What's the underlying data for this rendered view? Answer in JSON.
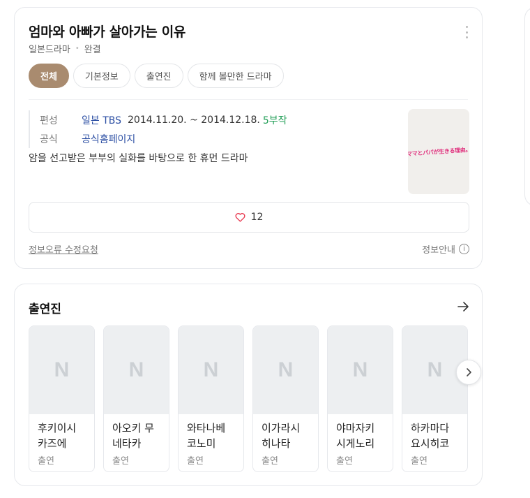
{
  "drama": {
    "title": "엄마와 아빠가 살아가는 이유",
    "genre": "일본드라마",
    "status": "완결"
  },
  "tabs": [
    {
      "label": "전체",
      "active": true
    },
    {
      "label": "기본정보",
      "active": false
    },
    {
      "label": "출연진",
      "active": false
    },
    {
      "label": "함께 볼만한 드라마",
      "active": false
    }
  ],
  "info": {
    "broadcast_label": "편성",
    "channel": "일본 TBS",
    "dates": "2014.11.20. ~ 2014.12.18.",
    "episodes": "5부작",
    "official_label": "공식",
    "official_link": "공식홈페이지"
  },
  "synopsis": "암을 선고받은 부부의 실화를 바탕으로 한 휴먼 드라마",
  "poster": {
    "text": "ママとパパが生きる理由。"
  },
  "likes": {
    "count": "12"
  },
  "footer": {
    "report_label": "정보오류 수정요청",
    "guide_label": "정보안내",
    "guide_icon": "i"
  },
  "cast_section": {
    "heading": "출연진",
    "placeholder_letter": "N",
    "members": [
      {
        "name": "후키이시 카즈에",
        "role": "출연"
      },
      {
        "name": "아오키 무네타카",
        "role": "출연"
      },
      {
        "name": "와타나베 코노미",
        "role": "출연"
      },
      {
        "name": "이가라시 히나타",
        "role": "출연"
      },
      {
        "name": "야마자키 시게노리",
        "role": "출연"
      },
      {
        "name": "하카마다 요시히코",
        "role": "출연"
      }
    ]
  },
  "colors": {
    "active_tab": "#a98b6f",
    "link": "#2b4ea3",
    "episodes": "#1f9d55",
    "heart": "#e8384f"
  }
}
